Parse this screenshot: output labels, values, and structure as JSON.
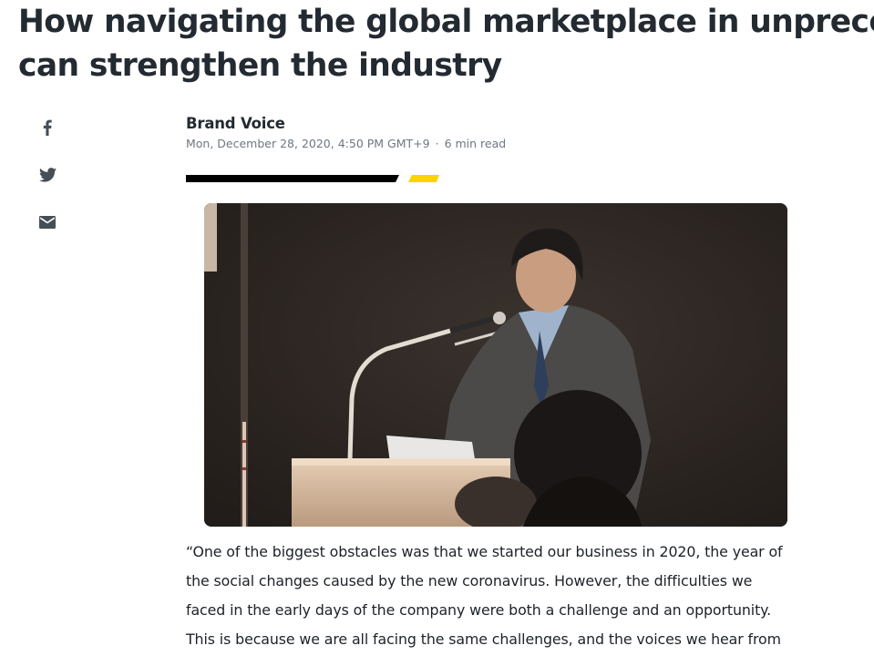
{
  "article": {
    "headline_lines": [
      "How navigating the global marketplace in unprecedented times",
      "can strengthen the industry"
    ],
    "author": "Brand Voice",
    "date": "Mon, December 28, 2020, 4:50 PM GMT+9",
    "separator": "·",
    "read_time": "6 min read",
    "body_lines": [
      "“One of the biggest obstacles was that we started our business in 2020, the year of",
      "the social changes caused by the new coronavirus. However, the difficulties we",
      "faced in the early days of the company were both a challenge and an opportunity.",
      "This is because we are all facing the same challenges, and the voices we hear from"
    ]
  },
  "share": [
    {
      "icon": "facebook-icon",
      "label": "Share on Facebook"
    },
    {
      "icon": "twitter-icon",
      "label": "Share on Twitter"
    },
    {
      "icon": "mail-icon",
      "label": "Share via Email"
    }
  ],
  "colors": {
    "headline": "#232a31",
    "meta": "#6e7780",
    "rule_dark": "#000000",
    "rule_accent": "#fdd200",
    "icon": "#464e56"
  }
}
